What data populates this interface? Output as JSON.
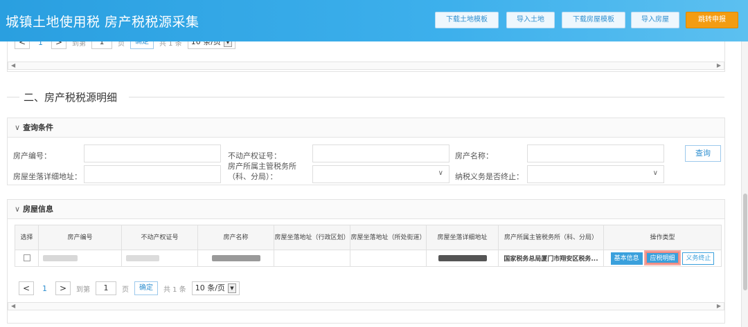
{
  "header": {
    "title": "城镇土地使用税 房产税税源采集",
    "buttons": [
      "下载土地模板",
      "导入土地",
      "下载房屋模板",
      "导入房屋",
      "跳转申报"
    ]
  },
  "top_pager": {
    "prev": "<",
    "page": "1",
    "next": ">",
    "goto_label": "到第",
    "goto_value": "1",
    "page_unit": "页",
    "confirm": "确定",
    "total": "共 1 条",
    "size": "10 条/页"
  },
  "section2": {
    "title": "二、房产税税源明细"
  },
  "query": {
    "head": "查询条件",
    "labels": {
      "house_no": "房产编号：",
      "property_cert": "不动产权证号：",
      "house_name": "房产名称：",
      "address": "房屋坐落详细地址：",
      "tax_office_1": "房产所属主管税务所",
      "tax_office_2": "（科、分局）：",
      "terminated": "纳税义务是否终止："
    },
    "query_button": "查询"
  },
  "house_info": {
    "head": "房屋信息",
    "columns": [
      "选择",
      "房产编号",
      "不动产权证号",
      "房产名称",
      "房屋坐落地址（行政区划）",
      "房屋坐落地址（所处街道）",
      "房屋坐落详细地址",
      "房产所属主管税务所（科、分局）",
      "操作类型"
    ],
    "row": {
      "tax_office": "国家税务总局厦门市翔安区税务...",
      "actions": [
        "基本信息",
        "应税明细",
        "义务终止"
      ]
    },
    "pager": {
      "prev": "<",
      "page": "1",
      "next": ">",
      "goto_label": "到第",
      "goto_value": "1",
      "page_unit": "页",
      "confirm": "确定",
      "total": "共 1 条",
      "size": "10 条/页"
    }
  },
  "colors": {
    "header_blue": "#2a9fe0",
    "accent_orange": "#f39c12",
    "link_blue": "#2f8fd0",
    "highlight": "#f28b82"
  }
}
